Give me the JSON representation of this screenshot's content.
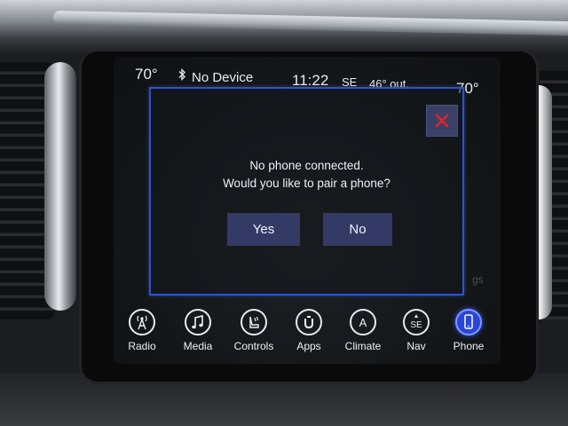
{
  "status_bar": {
    "temp_left": "70°",
    "device": "No Device",
    "bluetooth_icon": "bluetooth-icon",
    "clock": "11:22",
    "heading": "SE",
    "outside_temp": "46° out.",
    "temp_right": "70°"
  },
  "dialog": {
    "line1": "No phone connected.",
    "line2": "Would you like to pair a phone?",
    "yes_label": "Yes",
    "no_label": "No",
    "close_icon": "close-icon",
    "background_text": "gs"
  },
  "nav": {
    "items": [
      {
        "label": "Radio",
        "icon": "radio-tower-icon"
      },
      {
        "label": "Media",
        "icon": "music-note-icon"
      },
      {
        "label": "Controls",
        "icon": "controls-seat-icon"
      },
      {
        "label": "Apps",
        "icon": "apps-uconnect-icon"
      },
      {
        "label": "Climate",
        "icon": "climate-icon",
        "glyph": "A"
      },
      {
        "label": "Nav",
        "icon": "compass-icon",
        "glyph": "SE"
      },
      {
        "label": "Phone",
        "icon": "phone-icon",
        "active": true
      }
    ]
  },
  "colors": {
    "dialog_border": "#2f53c9",
    "button_bg": "#343a66",
    "close_x": "#e2232a",
    "active_accent": "#2a45d6"
  }
}
